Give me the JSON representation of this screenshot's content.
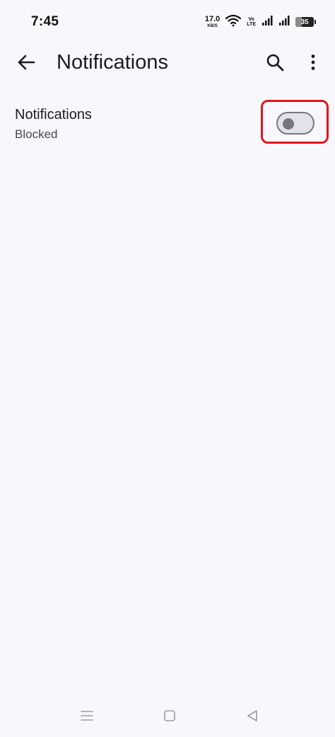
{
  "status_bar": {
    "time": "7:45",
    "net_speed_value": "17.0",
    "net_speed_unit": "KB/S",
    "volte_top": "Vo",
    "volte_bottom": "LTE",
    "battery_level": "35",
    "icons": [
      "wifi-icon",
      "volte-icon",
      "signal-icon",
      "signal-icon",
      "battery-icon"
    ]
  },
  "app_bar": {
    "title": "Notifications",
    "back_icon": "arrow-left-icon",
    "search_icon": "search-icon",
    "more_icon": "more-vertical-icon"
  },
  "setting": {
    "title": "Notifications",
    "subtitle": "Blocked",
    "toggle_on": false
  },
  "colors": {
    "background": "#f8f8fc",
    "highlight": "#e0141e",
    "toggle_outline": "#777680",
    "toggle_track": "#e3e1ec"
  },
  "nav_bar": {
    "icons": [
      "menu-icon",
      "home-icon",
      "back-triangle-icon"
    ]
  }
}
